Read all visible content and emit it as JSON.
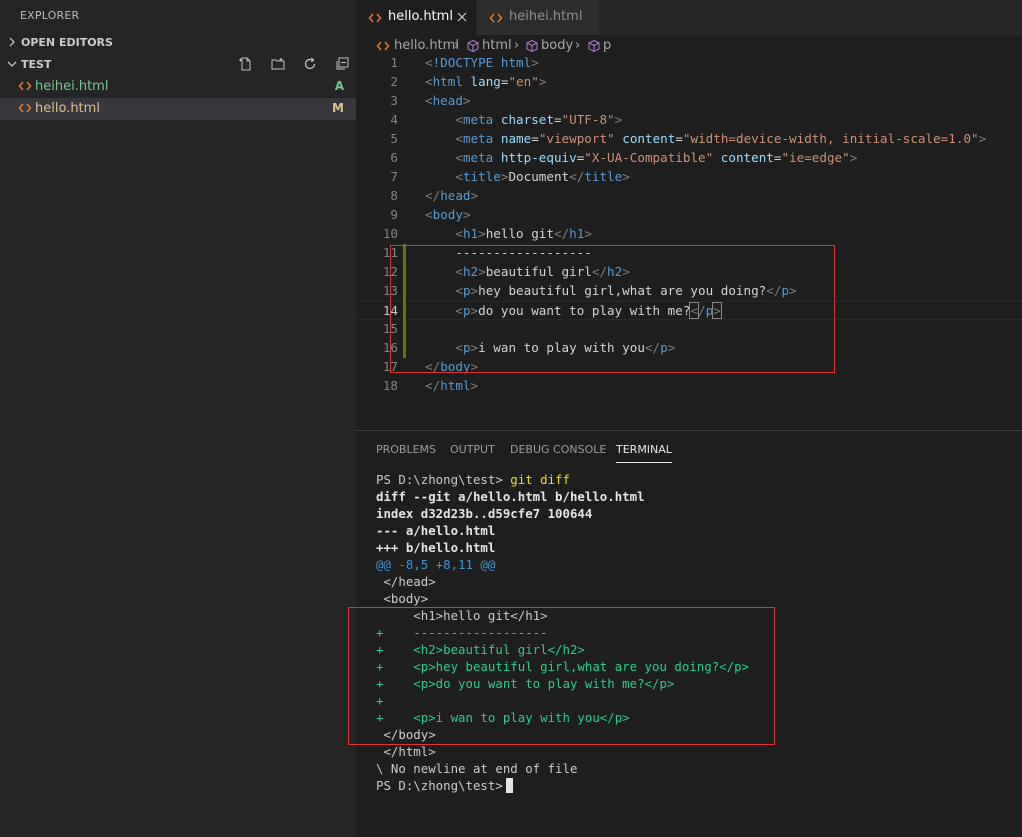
{
  "explorer": {
    "title": "EXPLORER",
    "open_editors_label": "OPEN EDITORS",
    "folder_label": "TEST",
    "files": [
      {
        "name": "heihei.html",
        "badge": "A",
        "color": "#73c991"
      },
      {
        "name": "hello.html",
        "badge": "M",
        "color": "#e2c08d"
      }
    ]
  },
  "tabs": [
    {
      "name": "hello.html"
    },
    {
      "name": "heihei.html"
    }
  ],
  "breadcrumb": [
    "hello.html",
    "html",
    "body",
    "p"
  ],
  "editor": {
    "line_numbers": [
      "1",
      "2",
      "3",
      "4",
      "5",
      "6",
      "7",
      "8",
      "9",
      "10",
      "11",
      "12",
      "13",
      "14",
      "15",
      "16",
      "17",
      "18"
    ],
    "lines": [
      "<!DOCTYPE html>",
      "<html lang=\"en\">",
      "<head>",
      "    <meta charset=\"UTF-8\">",
      "    <meta name=\"viewport\" content=\"width=device-width, initial-scale=1.0\">",
      "    <meta http-equiv=\"X-UA-Compatible\" content=\"ie=edge\">",
      "    <title>Document</title>",
      "</head>",
      "<body>",
      "    <h1>hello git</h1>",
      "    ------------------",
      "    <h2>beautiful girl</h2>",
      "    <p>hey beautiful girl,what are you doing?</p>",
      "    <p>do you want to play with me?</p>",
      "",
      "    <p>i wan to play with you</p>",
      "</body>",
      "</html>"
    ],
    "current_line": "14"
  },
  "panel": {
    "tabs": [
      "PROBLEMS",
      "OUTPUT",
      "DEBUG CONSOLE",
      "TERMINAL"
    ],
    "active_tab": "TERMINAL"
  },
  "terminal": {
    "prompt": "PS D:\\zhong\\test>",
    "command": "git diff",
    "lines": [
      "diff --git a/hello.html b/hello.html",
      "index d32d23b..d59cfe7 100644",
      "--- a/hello.html",
      "+++ b/hello.html",
      "@@ -8,5 +8,11 @@",
      " </head>",
      " <body>",
      "     <h1>hello git</h1>",
      "+    ------------------",
      "+    <h2>beautiful girl</h2>",
      "+    <p>hey beautiful girl,what are you doing?</p>",
      "+    <p>do you want to play with me?</p>",
      "+",
      "+    <p>i wan to play with you</p>",
      " </body>",
      " </html>",
      "\\ No newline at end of file"
    ],
    "final_prompt": "PS D:\\zhong\\test>"
  },
  "colors": {
    "added": "#23d18b",
    "hunk": "#3a96dd",
    "highlight_box": "#e0342e"
  }
}
